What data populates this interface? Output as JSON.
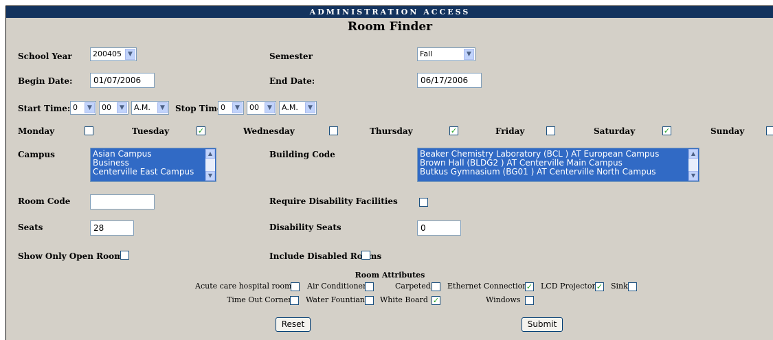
{
  "header": {
    "banner": "ADMINISTRATION ACCESS",
    "title": "Room Finder"
  },
  "form": {
    "school_year": {
      "label": "School Year",
      "value": "200405"
    },
    "semester": {
      "label": "Semester",
      "value": "Fall"
    },
    "begin_date": {
      "label": "Begin Date:",
      "value": "01/07/2006"
    },
    "end_date": {
      "label": "End Date:",
      "value": "06/17/2006"
    },
    "start_time": {
      "label": "Start Time:",
      "hour": "0",
      "minute": "00",
      "ampm": "A.M."
    },
    "stop_time": {
      "label": "Stop Time:",
      "hour": "0",
      "minute": "00",
      "ampm": "A.M."
    },
    "days": [
      {
        "label": "Monday",
        "checked": false
      },
      {
        "label": "Tuesday",
        "checked": true
      },
      {
        "label": "Wednesday",
        "checked": false
      },
      {
        "label": "Thursday",
        "checked": true
      },
      {
        "label": "Friday",
        "checked": false
      },
      {
        "label": "Saturday",
        "checked": true
      },
      {
        "label": "Sunday",
        "checked": false
      }
    ],
    "campus": {
      "label": "Campus",
      "options": [
        "Asian Campus",
        "Business",
        "Centerville East Campus"
      ]
    },
    "building_code": {
      "label": "Building Code",
      "options": [
        "Beaker Chemistry Laboratory (BCL ) AT European Campus",
        "Brown Hall (BLDG2 ) AT Centerville Main Campus",
        "Butkus Gymnasium (BG01 ) AT Centerville North Campus"
      ]
    },
    "room_code": {
      "label": "Room Code",
      "value": ""
    },
    "require_disability": {
      "label": "Require Disability Facilities",
      "checked": false
    },
    "seats": {
      "label": "Seats",
      "value": "28"
    },
    "disability_seats": {
      "label": "Disability Seats",
      "value": "0"
    },
    "show_open": {
      "label": "Show Only Open Rooms",
      "checked": false
    },
    "include_disabled": {
      "label": "Include Disabled Rooms",
      "checked": false
    }
  },
  "attributes": {
    "heading": "Room Attributes",
    "items": [
      {
        "label": "Acute care hospital room",
        "checked": false
      },
      {
        "label": "Air Conditioner",
        "checked": false
      },
      {
        "label": "Carpeted",
        "checked": false
      },
      {
        "label": "Ethernet Connection",
        "checked": true
      },
      {
        "label": "LCD Projector",
        "checked": true
      },
      {
        "label": "Sink",
        "checked": false
      },
      {
        "label": "Time Out Corner",
        "checked": false
      },
      {
        "label": "Water Fountian",
        "checked": false
      },
      {
        "label": "White Board",
        "checked": true
      },
      {
        "label": "Windows",
        "checked": false
      }
    ]
  },
  "buttons": {
    "reset": "Reset",
    "submit": "Submit"
  },
  "icons": {
    "dropdown": "chevron-down-icon",
    "check": "checkmark-icon",
    "scroll_up": "scroll-up-icon",
    "scroll_down": "scroll-down-icon"
  }
}
